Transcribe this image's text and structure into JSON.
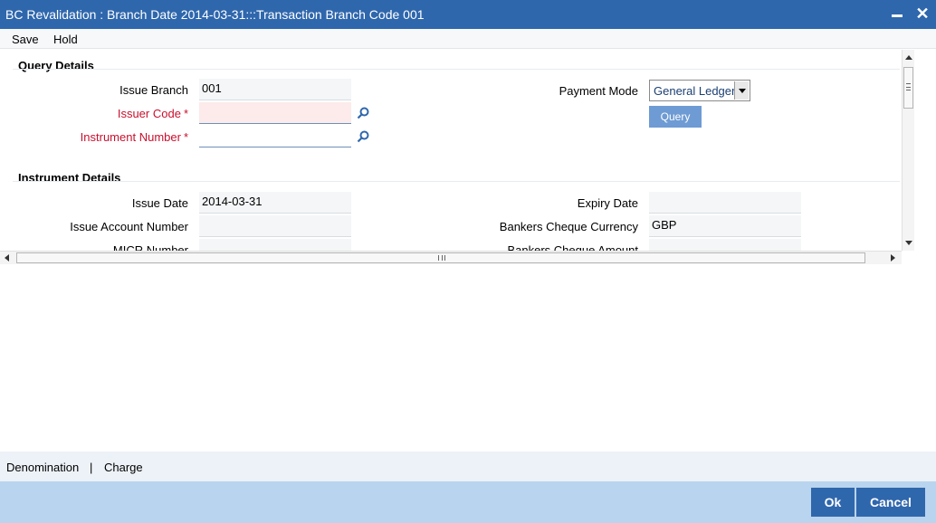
{
  "window": {
    "title": "BC Revalidation : Branch Date 2014-03-31:::Transaction Branch Code 001",
    "minimize_icon": "minimize-icon",
    "close_icon": "close-icon",
    "close_glyph": "✕"
  },
  "menu": {
    "save": "Save",
    "hold": "Hold"
  },
  "query_details": {
    "section_title": "Query Details",
    "issue_branch_label": "Issue Branch",
    "issue_branch_value": "001",
    "issuer_code_label": "Issuer Code",
    "issuer_code_value": "",
    "instrument_number_label": "Instrument Number",
    "instrument_number_value": "",
    "required_mark": "*",
    "payment_mode_label": "Payment Mode",
    "payment_mode_value": "General Ledger",
    "query_button": "Query"
  },
  "instrument_details": {
    "section_title": "Instrument Details",
    "issue_date_label": "Issue Date",
    "issue_date_value": "2014-03-31",
    "expiry_date_label": "Expiry Date",
    "expiry_date_value": "",
    "issue_account_number_label": "Issue Account Number",
    "issue_account_number_value": "",
    "bankers_cheque_currency_label": "Bankers Cheque Currency",
    "bankers_cheque_currency_value": "GBP",
    "micr_number_label": "MICR Number",
    "bankers_cheque_amount_label": "Bankers Cheque Amount"
  },
  "footer": {
    "denomination": "Denomination",
    "divider": "|",
    "charge": "Charge"
  },
  "buttons": {
    "ok": "Ok",
    "cancel": "Cancel"
  },
  "colors": {
    "titlebar": "#2f67ad",
    "required": "#c8102e",
    "button_bar": "#b9d4ee",
    "query_button": "#6e9bd3"
  }
}
